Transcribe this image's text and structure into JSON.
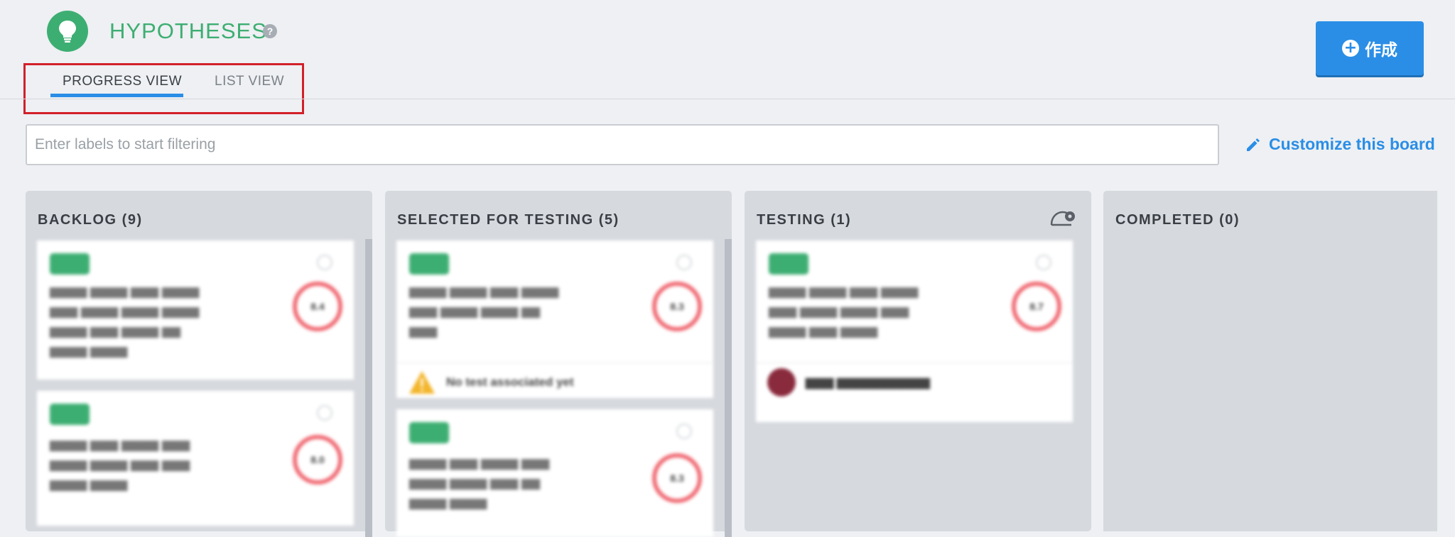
{
  "header": {
    "title": "HYPOTHESES",
    "help_icon": "?",
    "icon": "lightbulb-icon",
    "accent_color": "#3dae72"
  },
  "create_button": {
    "label": "作成",
    "icon": "plus-circle-icon",
    "color": "#2a8ee6"
  },
  "tabs": [
    {
      "label": "PROGRESS VIEW",
      "active": true
    },
    {
      "label": "LIST VIEW",
      "active": false
    }
  ],
  "filter": {
    "placeholder": "Enter labels to start filtering",
    "value": ""
  },
  "customize_link": {
    "label": "Customize this board",
    "icon": "pencil-icon"
  },
  "columns": [
    {
      "title": "BACKLOG (9)"
    },
    {
      "title": "SELECTED FOR TESTING (5)"
    },
    {
      "title": "TESTING (1)"
    },
    {
      "title": "COMPLETED (0)"
    }
  ],
  "cards": {
    "backlog_1": {
      "score": "8.4"
    },
    "backlog_2": {
      "score": "8.0"
    },
    "selected_1": {
      "score": "8.3",
      "warning": "No test associated yet"
    },
    "selected_2": {
      "score": "8.3"
    },
    "testing_1": {
      "score": "8.7"
    }
  }
}
